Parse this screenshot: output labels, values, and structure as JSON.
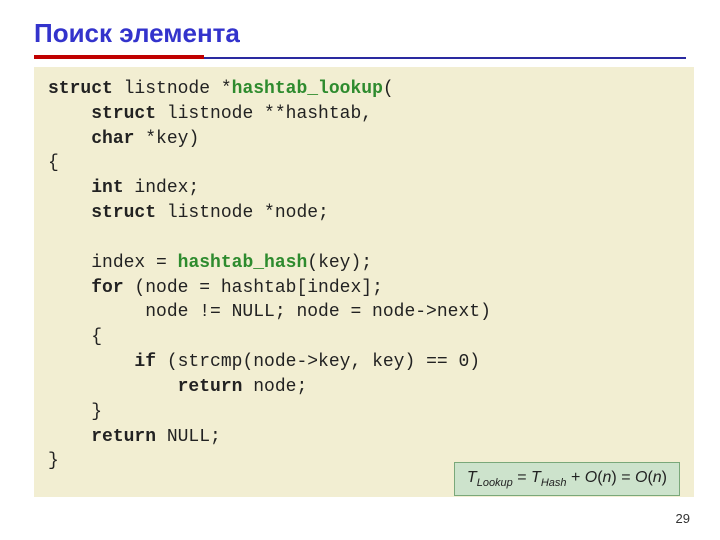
{
  "title": "Поиск элемента",
  "code": {
    "l1_kw1": "struct",
    "l1_txt1": " listnode *",
    "l1_fn": "hashtab_lookup",
    "l1_txt2": "(",
    "l2_ind": "    ",
    "l2_kw": "struct",
    "l2_txt": " listnode **hashtab,",
    "l3_ind": "    ",
    "l3_kw": "char",
    "l3_txt": " *key)",
    "l4": "{",
    "l5_ind": "    ",
    "l5_kw": "int",
    "l5_txt": " index;",
    "l6_ind": "    ",
    "l6_kw": "struct",
    "l6_txt": " listnode *node;",
    "l7": "",
    "l8_ind": "    ",
    "l8_txt1": "index = ",
    "l8_fn": "hashtab_hash",
    "l8_txt2": "(key);",
    "l9_ind": "    ",
    "l9_kw": "for",
    "l9_txt": " (node = hashtab[index];",
    "l10": "         node != NULL; node = node->next)",
    "l11": "    {",
    "l12_ind": "        ",
    "l12_kw": "if",
    "l12_txt": " (strcmp(node->key, key) == 0)",
    "l13_ind": "            ",
    "l13_kw": "return",
    "l13_txt": " node;",
    "l14": "    }",
    "l15_ind": "    ",
    "l15_kw": "return",
    "l15_txt": " NULL;",
    "l16": "}"
  },
  "complexity": {
    "T": "T",
    "lookup": "Lookup",
    "eq": " = ",
    "hash": "Hash",
    "plus": " + ",
    "O": "O",
    "lp": "(",
    "n": "n",
    "rp": ")",
    "eq2": " = "
  },
  "page_number": "29"
}
